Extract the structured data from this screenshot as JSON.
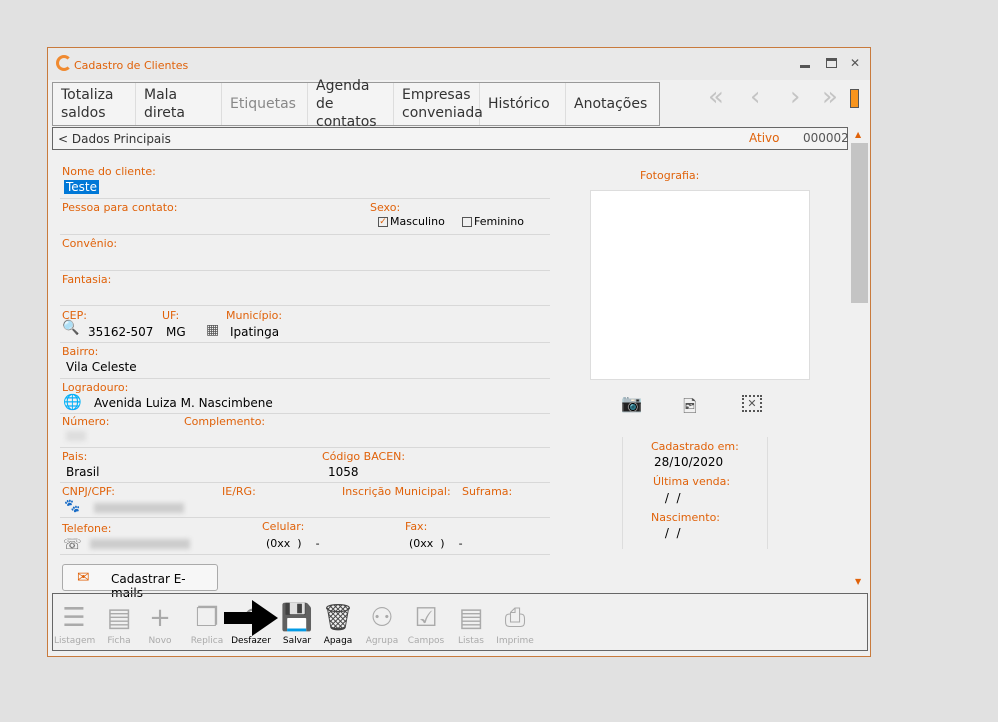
{
  "window": {
    "title": "Cadastro de Clientes",
    "min": "▬",
    "max": "▭",
    "close": "✕"
  },
  "tabs": [
    {
      "label": "Totaliza saldos"
    },
    {
      "label": "Mala direta"
    },
    {
      "label": "Etiquetas"
    },
    {
      "label": "Agenda de contatos"
    },
    {
      "label": "Empresas conveniada"
    },
    {
      "label": "Histórico"
    },
    {
      "label": "Anotações"
    }
  ],
  "nav": {
    "first": "«",
    "prev": "‹",
    "next": "›",
    "last": "»"
  },
  "section": {
    "title": "< Dados Principais",
    "status": "Ativo",
    "code": "000002"
  },
  "fields": {
    "nome_label": "Nome do cliente:",
    "nome": "Teste",
    "contato_label": "Pessoa para contato:",
    "sexo_label": "Sexo:",
    "masculino": "Masculino",
    "feminino": "Feminino",
    "convenio_label": "Convênio:",
    "fantasia_label": "Fantasia:",
    "cep_label": "CEP:",
    "cep": "35162-507",
    "uf_label": "UF:",
    "uf": "MG",
    "municipio_label": "Município:",
    "municipio": "Ipatinga",
    "bairro_label": "Bairro:",
    "bairro": "Vila Celeste",
    "logradouro_label": "Logradouro:",
    "logradouro": "Avenida Luiza M. Nascimbene",
    "numero_label": "Número:",
    "complemento_label": "Complemento:",
    "pais_label": "Pais:",
    "pais": "Brasil",
    "bacen_label": "Código BACEN:",
    "bacen": "1058",
    "cnpj_label": "CNPJ/CPF:",
    "ie_label": "IE/RG:",
    "im_label": "Inscrição Municipal:",
    "suframa_label": "Suframa:",
    "telefone_label": "Telefone:",
    "celular_label": "Celular:",
    "celular": "(0xx  )    -",
    "fax_label": "Fax:",
    "fax": "(0xx  )    -"
  },
  "emails_button": "Cadastrar E-mails",
  "photo": {
    "label": "Fotografia:"
  },
  "dates": {
    "cadastrado_label": "Cadastrado em:",
    "cadastrado": "28/10/2020",
    "ultima_label": "Última venda:",
    "ultima": " /  /",
    "nasc_label": "Nascimento:",
    "nasc": " /  /"
  },
  "toolbar": [
    {
      "label": "Listagem",
      "icon": "☰"
    },
    {
      "label": "Ficha",
      "icon": "▤"
    },
    {
      "label": "Novo",
      "icon": "+"
    },
    {
      "label": "Replica",
      "icon": "❐"
    },
    {
      "label": "Desfazer",
      "icon": "↶"
    },
    {
      "label": "Salvar",
      "icon": "💾"
    },
    {
      "label": "Apaga",
      "icon": "🗑"
    },
    {
      "label": "Agrupa",
      "icon": "⚇"
    },
    {
      "label": "Campos",
      "icon": "☑"
    },
    {
      "label": "Listas",
      "icon": "▤"
    },
    {
      "label": "Imprime",
      "icon": "⎙"
    }
  ],
  "colors": {
    "accent": "#e0620a"
  }
}
